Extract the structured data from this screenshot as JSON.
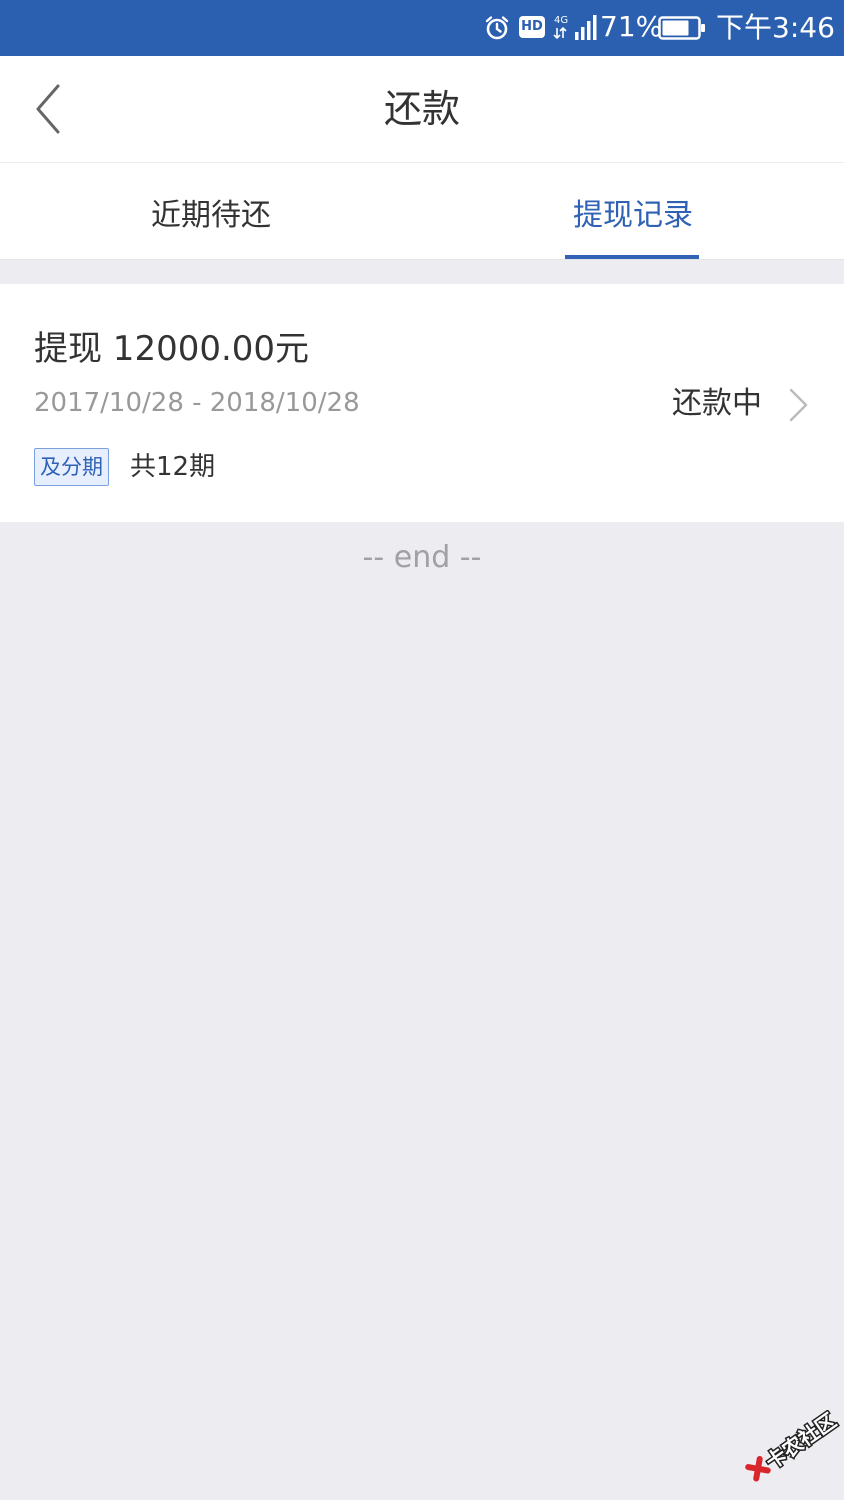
{
  "status_bar": {
    "battery_text": "71%",
    "time": "下午3:46",
    "hd_label": "HD",
    "network_label": "4G",
    "icons": [
      "alarm-icon",
      "hd-icon",
      "signal-icon",
      "battery-icon"
    ]
  },
  "nav": {
    "title": "还款",
    "back_icon": "chevron-left-icon"
  },
  "tabs": [
    {
      "label": "近期待还",
      "active": false
    },
    {
      "label": "提现记录",
      "active": true
    }
  ],
  "record": {
    "title": "提现 12000.00元",
    "period": "2017/10/28 - 2018/10/28",
    "status": "还款中",
    "tag": "及分期",
    "installments": "共12期"
  },
  "list_end": "-- end --",
  "watermark": {
    "text": "卡农社区"
  },
  "colors": {
    "status_bar": "#2b5faf",
    "accent": "#2f62b4",
    "background": "#ededf1",
    "watermark_red": "#d8262c"
  }
}
